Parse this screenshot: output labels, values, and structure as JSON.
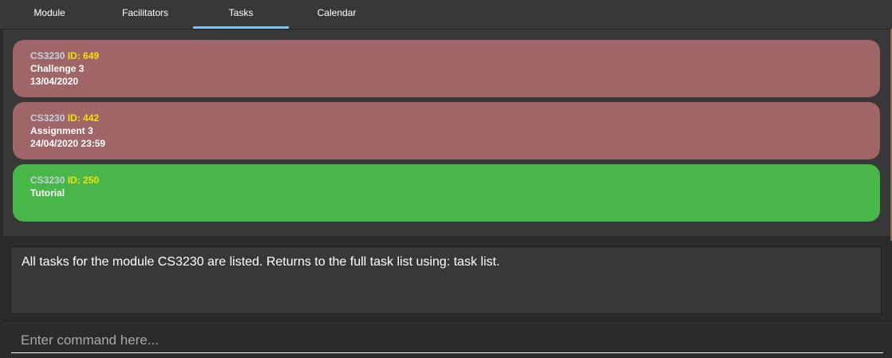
{
  "tabs": [
    {
      "label": "Module"
    },
    {
      "label": "Facilitators"
    },
    {
      "label": "Tasks",
      "active": true
    },
    {
      "label": "Calendar"
    }
  ],
  "tasks": [
    {
      "module_code": "CS3230",
      "id_label": "ID: 649",
      "description": "Challenge 3",
      "datetime": "13/04/2020",
      "color": "#a06667"
    },
    {
      "module_code": "CS3230",
      "id_label": "ID: 442",
      "description": "Assignment 3",
      "datetime": "24/04/2020 23:59",
      "color": "#a06667"
    },
    {
      "module_code": "CS3230",
      "id_label": "ID: 250",
      "description": "Tutorial",
      "datetime": "",
      "color": "#48b648"
    }
  ],
  "result_display": {
    "text": "All tasks for the module CS3230 are listed. Returns to the full task list using: task list."
  },
  "command_box": {
    "value": "",
    "placeholder": "Enter command here..."
  },
  "colors": {
    "background": "#2b2b2b",
    "panel": "#383838",
    "tab_indicator": "#7cc4ec",
    "id_text": "#f2e30d",
    "module_code_text": "#c7cfe0"
  }
}
